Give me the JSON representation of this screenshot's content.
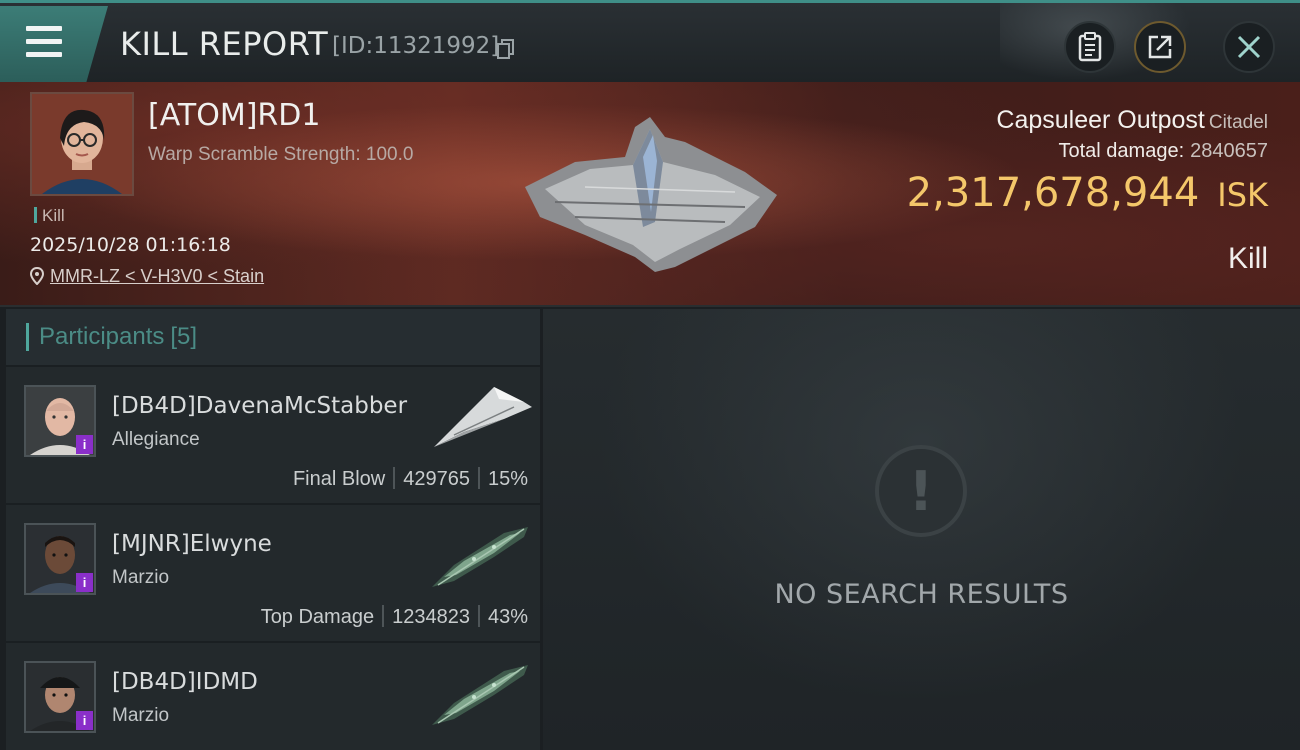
{
  "header": {
    "title": "KILL REPORT",
    "report_id": "[ID:11321992]",
    "icons": [
      "menu-icon",
      "copy-icon",
      "clipboard-icon",
      "share-icon",
      "close-icon"
    ]
  },
  "victim": {
    "pilot_name": "[ATOM]RD1",
    "warp_scramble": "Warp Scramble Strength: 100.0",
    "kill_tag": "Kill",
    "date": "2025/10/28 01:16:18",
    "location": "MMR-LZ < V-H3V0 < Stain",
    "target_name": "Capsuleer Outpost",
    "target_type": "Citadel",
    "total_damage_label": "Total damage:",
    "total_damage_value": "2840657",
    "isk_value": "2,317,678,944",
    "isk_unit": "ISK",
    "result": "Kill"
  },
  "participants": {
    "label": "Participants",
    "count": "[5]",
    "items": [
      {
        "name": "[DB4D]DavenaMcStabber",
        "corp": "Allegiance",
        "role": "Final Blow",
        "damage": "429765",
        "percent": "15%",
        "badge": "i"
      },
      {
        "name": "[MJNR]Elwyne",
        "corp": "Marzio",
        "role": "Top Damage",
        "damage": "1234823",
        "percent": "43%",
        "badge": "i"
      },
      {
        "name": "[DB4D]IDMD",
        "corp": "Marzio",
        "role": "",
        "damage": "",
        "percent": "",
        "badge": "i"
      }
    ]
  },
  "results": {
    "empty_text": "NO SEARCH RESULTS"
  },
  "colors": {
    "accent_teal": "#4fa79d",
    "isk_gold": "#f4c76a",
    "badge_purple": "#8a2fc9"
  }
}
